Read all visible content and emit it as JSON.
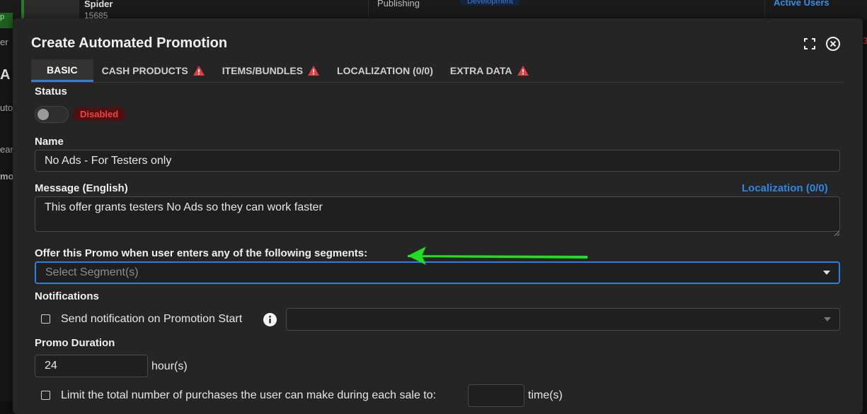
{
  "background": {
    "app_name": "Spider",
    "app_id": "15685",
    "publishing_label": "Publishing",
    "environment_badge": "Development",
    "active_users_label": "Active Users",
    "left_fragments": [
      "p",
      "er",
      "A",
      "uto",
      "ear",
      "mo"
    ],
    "right_fragment": "3"
  },
  "modal": {
    "title": "Create Automated Promotion",
    "tabs": [
      {
        "label": "BASIC",
        "warning": false,
        "active": true
      },
      {
        "label": "CASH PRODUCTS",
        "warning": true
      },
      {
        "label": "ITEMS/BUNDLES",
        "warning": true
      },
      {
        "label": "LOCALIZATION (0/0)",
        "warning": false
      },
      {
        "label": "EXTRA DATA",
        "warning": true
      }
    ],
    "status": {
      "label": "Status",
      "badge": "Disabled"
    },
    "name": {
      "label": "Name",
      "value": "No Ads - For Testers only"
    },
    "message": {
      "label": "Message (English)",
      "link": "Localization (0/0)",
      "value": "This offer grants testers No Ads so they can work faster"
    },
    "segments": {
      "label": "Offer this Promo when user enters any of the following segments:",
      "placeholder": "Select Segment(s)"
    },
    "notifications": {
      "label": "Notifications",
      "checkbox_label": "Send notification on Promotion Start",
      "select_value": ""
    },
    "duration": {
      "label": "Promo Duration",
      "value": "24",
      "unit": "hour(s)"
    },
    "limit": {
      "checkbox_label": "Limit the total number of purchases the user can make during each sale to:",
      "value": "",
      "unit": "time(s)"
    }
  },
  "colors": {
    "accent": "#2f7ee0",
    "danger": "#ff3b3b",
    "warning": "#e04040",
    "annotation_arrow": "#1fe01f"
  }
}
